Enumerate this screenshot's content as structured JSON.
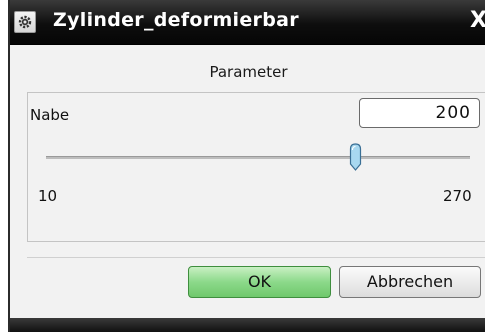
{
  "window": {
    "title": "Zylinder_deformierbar",
    "close_label": "X"
  },
  "group": {
    "title": "Parameter"
  },
  "field": {
    "label": "Nabe",
    "value": "200"
  },
  "slider": {
    "min_label": "10",
    "max_label": "270",
    "min": 10,
    "max": 270,
    "value": 200
  },
  "buttons": {
    "ok_label": "OK",
    "cancel_label": "Abbrechen"
  },
  "icons": {
    "title_icon": "gear-icon",
    "close": "close-icon",
    "slider_thumb": "slider-thumb"
  },
  "colors": {
    "ok_button": "#8cd98a",
    "slider_thumb": "#a8d8f0"
  }
}
